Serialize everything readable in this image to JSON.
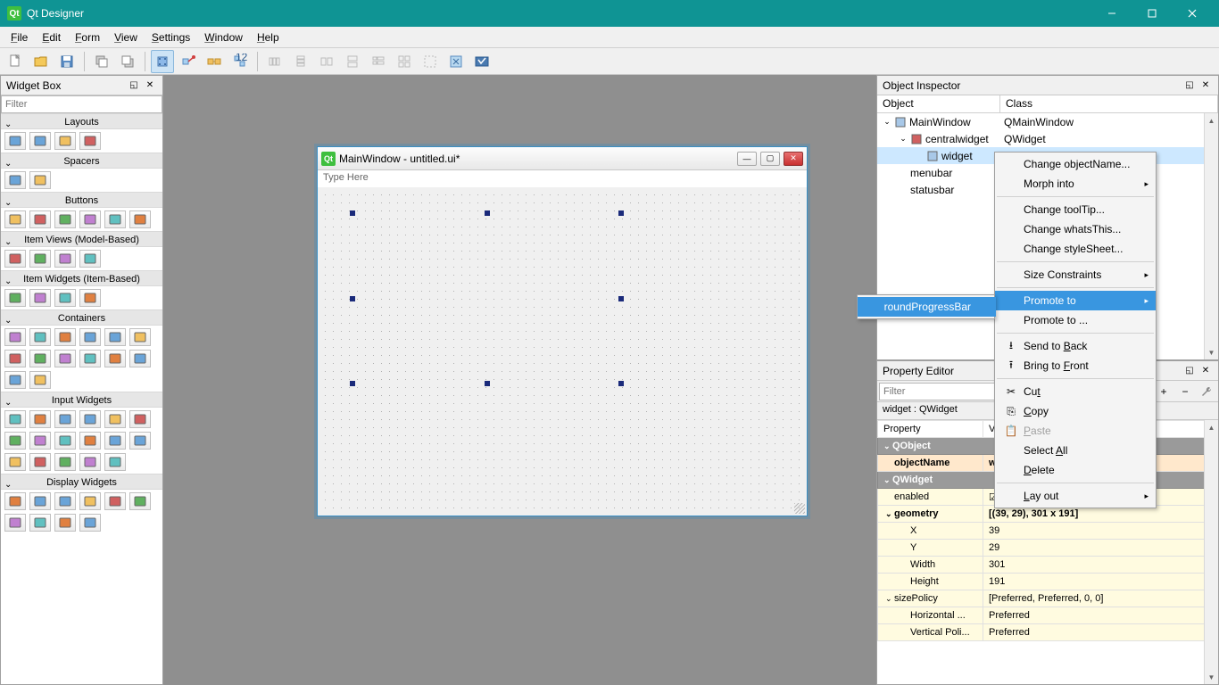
{
  "app": {
    "title": "Qt Designer"
  },
  "menubar": {
    "items": [
      "File",
      "Edit",
      "Form",
      "View",
      "Settings",
      "Window",
      "Help"
    ]
  },
  "widgetbox": {
    "title": "Widget Box",
    "filter_placeholder": "Filter",
    "sections": [
      "Layouts",
      "Spacers",
      "Buttons",
      "Item Views (Model-Based)",
      "Item Widgets (Item-Based)",
      "Containers",
      "Input Widgets",
      "Display Widgets"
    ]
  },
  "form_window": {
    "title": "MainWindow - untitled.ui*",
    "menu_placeholder": "Type Here"
  },
  "object_inspector": {
    "title": "Object Inspector",
    "columns": [
      "Object",
      "Class"
    ],
    "rows": [
      {
        "indent": 0,
        "exp": "⌄",
        "icon": "window",
        "name": "MainWindow",
        "class": "QMainWindow"
      },
      {
        "indent": 1,
        "exp": "⌄",
        "icon": "nolayout",
        "name": "centralwidget",
        "class": "QWidget"
      },
      {
        "indent": 2,
        "exp": "",
        "icon": "widget",
        "name": "widget",
        "class": "",
        "hl": true
      },
      {
        "indent": 1,
        "exp": "",
        "icon": "",
        "name": "menubar",
        "class": ""
      },
      {
        "indent": 1,
        "exp": "",
        "icon": "",
        "name": "statusbar",
        "class": ""
      }
    ]
  },
  "property_editor": {
    "title": "Property Editor",
    "filter_placeholder": "Filter",
    "subheader": "widget : QWidget",
    "columns": [
      "Property",
      "Value"
    ],
    "rows": [
      {
        "type": "group",
        "label": "QObject"
      },
      {
        "type": "prop",
        "style": "orange",
        "exp": "",
        "label": "objectName",
        "value": "widget",
        "bold": true
      },
      {
        "type": "group",
        "label": "QWidget"
      },
      {
        "type": "prop",
        "style": "yellow",
        "exp": "",
        "label": "enabled",
        "value": "☑"
      },
      {
        "type": "prop",
        "style": "yellow",
        "exp": "⌄",
        "label": "geometry",
        "value": "[(39, 29), 301 x 191]",
        "bold": true
      },
      {
        "type": "prop",
        "style": "yellow",
        "exp": "",
        "indent": 1,
        "label": "X",
        "value": "39"
      },
      {
        "type": "prop",
        "style": "yellow",
        "exp": "",
        "indent": 1,
        "label": "Y",
        "value": "29"
      },
      {
        "type": "prop",
        "style": "yellow",
        "exp": "",
        "indent": 1,
        "label": "Width",
        "value": "301"
      },
      {
        "type": "prop",
        "style": "yellow",
        "exp": "",
        "indent": 1,
        "label": "Height",
        "value": "191"
      },
      {
        "type": "prop",
        "style": "yellow",
        "exp": "⌄",
        "label": "sizePolicy",
        "value": "[Preferred, Preferred, 0, 0]"
      },
      {
        "type": "prop",
        "style": "yellow",
        "exp": "",
        "indent": 1,
        "label": "Horizontal ...",
        "value": "Preferred"
      },
      {
        "type": "prop",
        "style": "yellow",
        "exp": "",
        "indent": 1,
        "label": "Vertical Poli...",
        "value": "Preferred"
      }
    ]
  },
  "context_menu": {
    "items": [
      {
        "label": "Change objectName..."
      },
      {
        "label": "Morph into",
        "sub": true
      },
      {
        "sep": true
      },
      {
        "label": "Change toolTip..."
      },
      {
        "label": "Change whatsThis..."
      },
      {
        "label": "Change styleSheet..."
      },
      {
        "sep": true
      },
      {
        "label": "Size Constraints",
        "sub": true
      },
      {
        "sep": true
      },
      {
        "label": "Promote to",
        "sub": true,
        "highlight": true
      },
      {
        "label": "Promote to ..."
      },
      {
        "sep": true
      },
      {
        "label": "Send to Back",
        "icon": "back"
      },
      {
        "label": "Bring to Front",
        "icon": "front"
      },
      {
        "sep": true
      },
      {
        "label": "Cut",
        "icon": "cut"
      },
      {
        "label": "Copy",
        "icon": "copy"
      },
      {
        "label": "Paste",
        "icon": "paste",
        "disabled": true
      },
      {
        "label": "Select All"
      },
      {
        "label": "Delete"
      },
      {
        "sep": true
      },
      {
        "label": "Lay out",
        "sub": true
      }
    ],
    "submenu": [
      {
        "label": "roundProgressBar",
        "highlight": true
      }
    ]
  }
}
